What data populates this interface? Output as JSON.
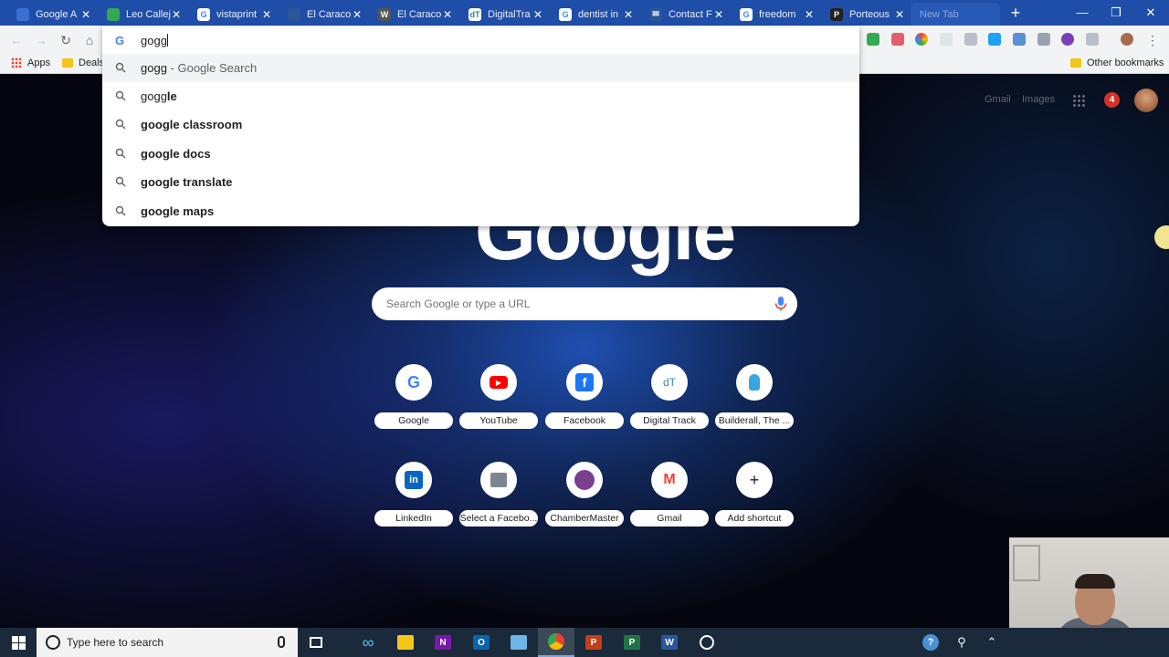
{
  "browser": {
    "tabs": [
      {
        "title": "Google A",
        "favicon": "document-icon",
        "color": "#3b6fd4"
      },
      {
        "title": "Leo Callej",
        "favicon": "google-ads-icon",
        "color": "#34a853"
      },
      {
        "title": "vistaprint",
        "favicon": "google-g-icon",
        "color": "#ffffff"
      },
      {
        "title": "El Caracol",
        "favicon": "user-group-icon",
        "color": "#2b5797"
      },
      {
        "title": "El Caracol",
        "favicon": "wordpress-icon",
        "color": "#555555"
      },
      {
        "title": "DigitalTra",
        "favicon": "digital-track-icon",
        "color": "#ffffff"
      },
      {
        "title": "dentist in",
        "favicon": "google-g-icon",
        "color": "#ffffff"
      },
      {
        "title": "Contact F",
        "favicon": "email-icon",
        "color": "#2b5797"
      },
      {
        "title": "freedom",
        "favicon": "google-g-icon",
        "color": "#ffffff"
      },
      {
        "title": "Porteous",
        "favicon": "porteous-icon",
        "color": "#222222"
      },
      {
        "title": "New Tab",
        "favicon": "",
        "color": ""
      }
    ],
    "new_tab_symbol": "+",
    "window": {
      "minimize": "—",
      "maximize": "❐",
      "close": "✕"
    },
    "bookmarks": {
      "apps_label": "Apps",
      "deals_label": "Deals",
      "other_label": "Other bookmarks"
    }
  },
  "omnibox": {
    "typed": "gogg",
    "suggestions": [
      {
        "prefix": "gogg",
        "bold": "",
        "suffix": " - Google Search",
        "highlighted": true
      },
      {
        "prefix": "gogg",
        "bold": "le",
        "suffix": "",
        "highlighted": false
      },
      {
        "prefix": "",
        "bold": "google classroom",
        "suffix": "",
        "highlighted": false
      },
      {
        "prefix": "",
        "bold": "google docs",
        "suffix": "",
        "highlighted": false
      },
      {
        "prefix": "",
        "bold": "google translate",
        "suffix": "",
        "highlighted": false
      },
      {
        "prefix": "",
        "bold": "google maps",
        "suffix": "",
        "highlighted": false
      }
    ]
  },
  "ntp": {
    "gmail_link": "Gmail",
    "images_link": "Images",
    "notification_count": "4",
    "logo_partial": "Google",
    "search_placeholder": "Search Google or type a URL",
    "shortcuts": [
      {
        "label": "Google",
        "icon": "google-g-icon"
      },
      {
        "label": "YouTube",
        "icon": "youtube-icon"
      },
      {
        "label": "Facebook",
        "icon": "facebook-icon"
      },
      {
        "label": "Digital Track",
        "icon": "digital-track-icon"
      },
      {
        "label": "Builderall, The ...",
        "icon": "builderall-icon"
      },
      {
        "label": "LinkedIn",
        "icon": "linkedin-icon"
      },
      {
        "label": "Select a Facebo...",
        "icon": "facebook-select-icon"
      },
      {
        "label": "ChamberMaster",
        "icon": "chambermaster-icon"
      },
      {
        "label": "Gmail",
        "icon": "gmail-icon"
      },
      {
        "label": "Add shortcut",
        "icon": "plus-icon"
      }
    ]
  },
  "taskbar": {
    "search_placeholder": "Type here to search"
  }
}
